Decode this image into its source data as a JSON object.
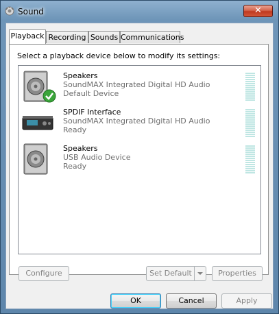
{
  "window": {
    "title": "Sound",
    "close_glyph": "✕"
  },
  "tabs": [
    {
      "label": "Playback",
      "active": true
    },
    {
      "label": "Recording",
      "active": false
    },
    {
      "label": "Sounds",
      "active": false
    },
    {
      "label": "Communications",
      "active": false
    }
  ],
  "instruction": "Select a playback device below to modify its settings:",
  "devices": [
    {
      "name": "Speakers",
      "description": "SoundMAX Integrated Digital HD Audio",
      "status": "Default Device",
      "icon": "speaker-icon",
      "default_badge": true
    },
    {
      "name": "SPDIF Interface",
      "description": "SoundMAX Integrated Digital HD Audio",
      "status": "Ready",
      "icon": "spdif-device-icon",
      "default_badge": false
    },
    {
      "name": "Speakers",
      "description": "USB Audio Device",
      "status": "Ready",
      "icon": "speaker-icon",
      "default_badge": false
    }
  ],
  "buttons": {
    "configure": "Configure",
    "set_default": "Set Default",
    "properties": "Properties",
    "ok": "OK",
    "cancel": "Cancel",
    "apply": "Apply"
  },
  "colors": {
    "level_meter": "#bfe6e3",
    "check_badge": "#3aa53a",
    "close_button": "#c0391f"
  }
}
